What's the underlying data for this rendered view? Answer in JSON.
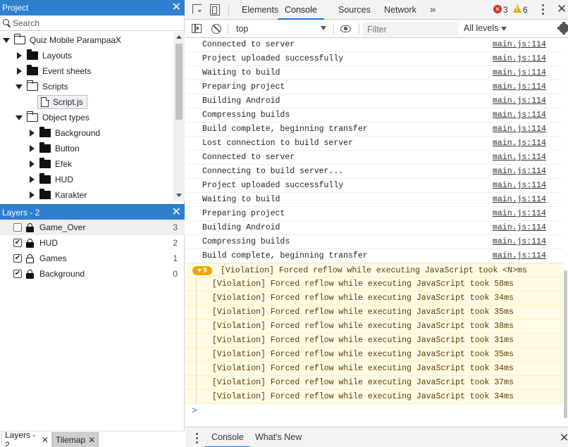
{
  "project_panel": {
    "title": "Project",
    "search_placeholder": "Search",
    "tree": [
      {
        "label": "Quiz Mobile ParampaaX",
        "expanded": true,
        "icon": "folder-open-icon"
      },
      {
        "label": "Layouts",
        "expanded": false,
        "icon": "folder-icon"
      },
      {
        "label": "Event sheets",
        "expanded": false,
        "icon": "folder-icon"
      },
      {
        "label": "Scripts",
        "expanded": true,
        "icon": "folder-open-icon"
      },
      {
        "label": "Script.js",
        "icon": "file-icon"
      },
      {
        "label": "Object types",
        "expanded": true,
        "icon": "folder-open-icon"
      },
      {
        "label": "Background",
        "expanded": false,
        "icon": "folder-icon"
      },
      {
        "label": "Button",
        "expanded": false,
        "icon": "folder-icon"
      },
      {
        "label": "Efek",
        "expanded": false,
        "icon": "folder-icon"
      },
      {
        "label": "HUD",
        "expanded": false,
        "icon": "folder-icon"
      },
      {
        "label": "Karakter",
        "expanded": false,
        "icon": "folder-icon"
      }
    ]
  },
  "layers_panel": {
    "title": "Layers - 2",
    "layers": [
      {
        "name": "Game_Over",
        "checked": false,
        "locked": true,
        "index": "3"
      },
      {
        "name": "HUD",
        "checked": true,
        "locked": true,
        "index": "2"
      },
      {
        "name": "Games",
        "checked": true,
        "locked": false,
        "index": "1"
      },
      {
        "name": "Background",
        "checked": true,
        "locked": true,
        "index": "0"
      }
    ]
  },
  "bottom_tabs": [
    {
      "label": "Layers - 2",
      "active": true
    },
    {
      "label": "Tilemap",
      "active": false
    }
  ],
  "devtools": {
    "tabs": [
      "Elements",
      "Console",
      "Sources",
      "Network"
    ],
    "active_tab": "Console",
    "more_tabs_glyph": "»",
    "error_count": "3",
    "warning_count": "6",
    "error_glyph": "✕",
    "warning_glyph": "!",
    "context": "top",
    "filter_placeholder": "Filter",
    "levels_label": "All levels",
    "colors": {
      "accent": "#1a73e8",
      "error": "#d93025",
      "warning": "#f2a600",
      "warning_bg": "#fffbe5"
    }
  },
  "console": {
    "logs": [
      {
        "msg": "Connected to server",
        "src": "main.js:114"
      },
      {
        "msg": "Project uploaded successfully",
        "src": "main.js:114"
      },
      {
        "msg": "Waiting to build",
        "src": "main.js:114"
      },
      {
        "msg": "Preparing project",
        "src": "main.js:114"
      },
      {
        "msg": "Building Android",
        "src": "main.js:114"
      },
      {
        "msg": "Compressing builds",
        "src": "main.js:114"
      },
      {
        "msg": "Build complete, beginning transfer",
        "src": "main.js:114"
      },
      {
        "msg": "Lost connection to build server",
        "src": "main.js:114"
      },
      {
        "msg": "Connected to server",
        "src": "main.js:114"
      },
      {
        "msg": "Connecting to build server...",
        "src": "main.js:114"
      },
      {
        "msg": "Project uploaded successfully",
        "src": "main.js:114"
      },
      {
        "msg": "Waiting to build",
        "src": "main.js:114"
      },
      {
        "msg": "Preparing project",
        "src": "main.js:114"
      },
      {
        "msg": "Building Android",
        "src": "main.js:114"
      },
      {
        "msg": "Compressing builds",
        "src": "main.js:114"
      },
      {
        "msg": "Build complete, beginning transfer",
        "src": "main.js:114"
      }
    ],
    "violation_group": {
      "count": "9",
      "msg": "[Violation] Forced reflow while executing JavaScript took <N>ms",
      "items": [
        "[Violation] Forced reflow while executing JavaScript took 58ms",
        "[Violation] Forced reflow while executing JavaScript took 34ms",
        "[Violation] Forced reflow while executing JavaScript took 35ms",
        "[Violation] Forced reflow while executing JavaScript took 38ms",
        "[Violation] Forced reflow while executing JavaScript took 31ms",
        "[Violation] Forced reflow while executing JavaScript took 35ms",
        "[Violation] Forced reflow while executing JavaScript took 34ms",
        "[Violation] Forced reflow while executing JavaScript took 37ms",
        "[Violation] Forced reflow while executing JavaScript took 34ms"
      ]
    },
    "prompt_glyph": ">"
  },
  "drawer": {
    "tabs": [
      "Console",
      "What's New"
    ],
    "active_tab": "Console"
  }
}
